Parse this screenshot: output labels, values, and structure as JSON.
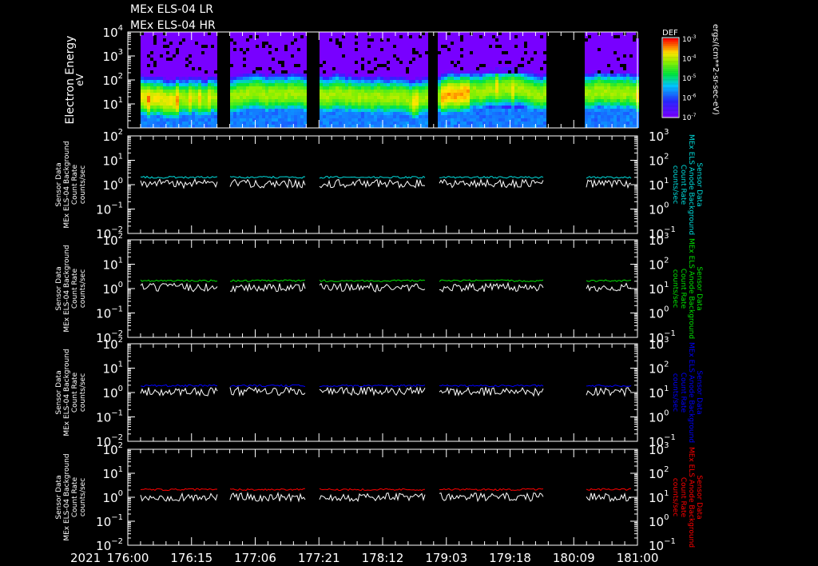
{
  "titles": [
    "MEx ELS-04 LR",
    "MEx ELS-04 HR"
  ],
  "chart_data": [
    {
      "type": "heatmap",
      "title": "MEx ELS-04 LR / MEx ELS-04 HR",
      "ylabel": "Electron Energy",
      "yunit": "eV",
      "yscale": "log",
      "ylim": [
        1,
        10000
      ],
      "yticks": [
        "10",
        "10",
        "10",
        "10"
      ],
      "yticks_exp": [
        "4",
        "3",
        "2",
        "1"
      ],
      "colorbar": {
        "title": "DEF",
        "unit": "ergs/(cm**2-sr-sec-eV)",
        "range": [
          1e-07,
          0.001
        ],
        "ticks_exp": [
          "-3",
          "-4",
          "-5",
          "-6",
          "-7"
        ]
      },
      "peak_energy_eV": 25,
      "data_gaps_hours": [
        [
          0,
          3
        ],
        [
          21.1,
          23.9
        ],
        [
          41.9,
          44.8
        ],
        [
          70.2,
          73.0
        ],
        [
          98.0,
          107.6
        ]
      ]
    },
    {
      "type": "line",
      "ylabel_left": [
        "Sensor Data",
        "MEx ELS-04 Background",
        "Count Rate",
        "counts/sec"
      ],
      "ylabel_right": [
        "Sensor Data",
        "MEx ELS Anode Background",
        "Count Rate",
        "counts/sec"
      ],
      "ylim_left": [
        0.01,
        100
      ],
      "ylim_right": [
        0.1,
        1000
      ],
      "series": [
        {
          "name": "anode background",
          "color": "#00dcdc",
          "mean": 2.0
        },
        {
          "name": "ELS-04 background",
          "color": "#ffffff",
          "mean": 1.2
        }
      ]
    },
    {
      "type": "line",
      "ylabel_left": [
        "Sensor Data",
        "MEx ELS-04 Background",
        "Count Rate",
        "counts/sec"
      ],
      "ylabel_right": [
        "Sensor Data",
        "MEx ELS Anode Background",
        "Count Rate",
        "counts/sec"
      ],
      "ylim_left": [
        0.01,
        100
      ],
      "ylim_right": [
        0.1,
        1000
      ],
      "series": [
        {
          "name": "anode background",
          "color": "#00e000",
          "mean": 2.1
        },
        {
          "name": "ELS-04 background",
          "color": "#ffffff",
          "mean": 1.2
        }
      ]
    },
    {
      "type": "line",
      "ylabel_left": [
        "Sensor Data",
        "MEx ELS-04 Background",
        "Count Rate",
        "counts/sec"
      ],
      "ylabel_right": [
        "Sensor Data",
        "MEx ELS Anode Background",
        "Count Rate",
        "counts/sec"
      ],
      "ylim_left": [
        0.01,
        100
      ],
      "ylim_right": [
        0.1,
        1000
      ],
      "series": [
        {
          "name": "anode background",
          "color": "#0000ff",
          "mean": 1.9
        },
        {
          "name": "ELS-04 background",
          "color": "#ffffff",
          "mean": 1.2
        }
      ]
    },
    {
      "type": "line",
      "ylabel_left": [
        "Sensor Data",
        "MEx ELS-04 Background",
        "Count Rate",
        "counts/sec"
      ],
      "ylabel_right": [
        "Sensor Data",
        "MEx ELS Anode Background",
        "Count Rate",
        "counts/sec"
      ],
      "ylim_left": [
        0.01,
        100
      ],
      "ylim_right": [
        0.1,
        1000
      ],
      "series": [
        {
          "name": "anode background",
          "color": "#ff0000",
          "mean": 2.1
        },
        {
          "name": "ELS-04 background",
          "color": "#ffffff",
          "mean": 1.1
        }
      ]
    }
  ],
  "line_gaps_hours": [
    [
      0,
      3
    ],
    [
      21.1,
      23.9
    ],
    [
      41.9,
      44.8
    ],
    [
      70.2,
      73.0
    ],
    [
      98.0,
      107.6
    ],
    [
      118.5,
      120
    ]
  ],
  "xaxis": {
    "year": "2021",
    "range_hours": [
      0,
      120
    ],
    "tick_labels": [
      "176:00",
      "176:15",
      "177:06",
      "177:21",
      "178:12",
      "179:03",
      "179:18",
      "180:09",
      "181:00"
    ]
  }
}
